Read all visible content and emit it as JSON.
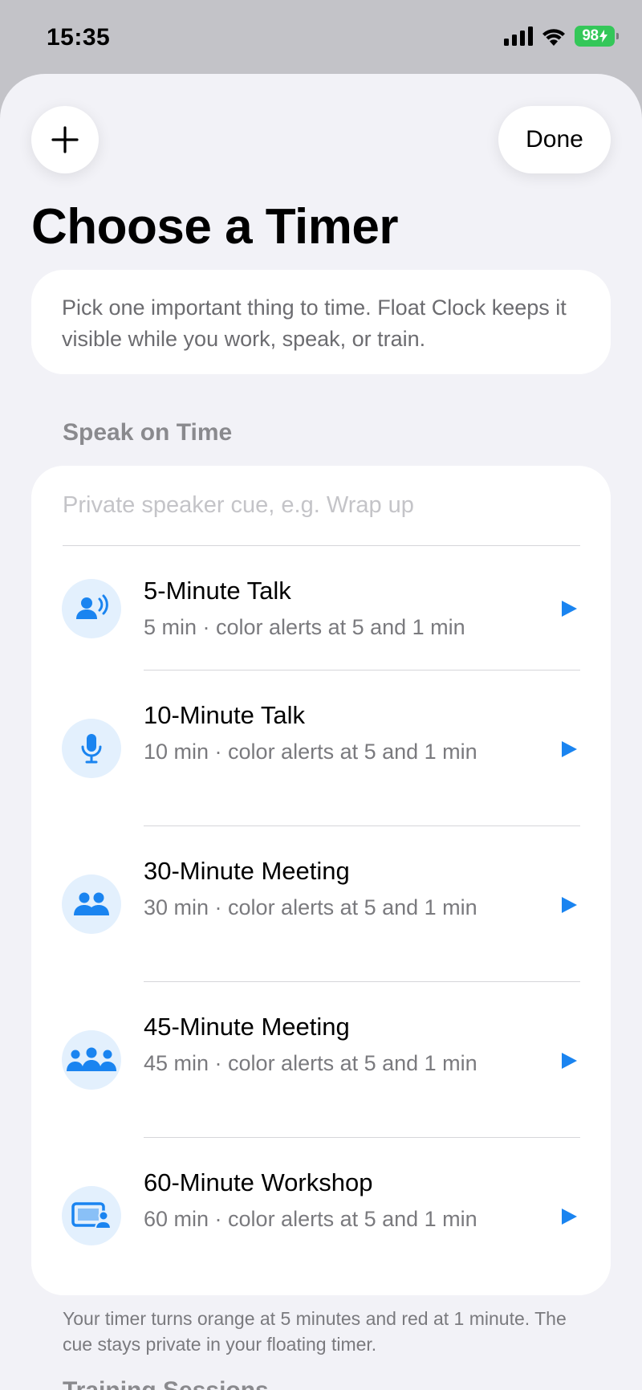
{
  "status": {
    "time": "15:35",
    "battery": "98"
  },
  "header": {
    "done_label": "Done",
    "title": "Choose a Timer"
  },
  "intro": "Pick one important thing to time. Float Clock keeps it visible while you work, speak, or train.",
  "section": {
    "title": "Speak on Time",
    "cue_placeholder": "Private speaker cue, e.g. Wrap up",
    "items": [
      {
        "title": "5-Minute Talk",
        "subtitle": "5 min · color alerts at 5 and 1 min",
        "icon": "speaker-icon"
      },
      {
        "title": "10-Minute Talk",
        "subtitle": "10 min · color alerts at 5 and 1 min",
        "icon": "microphone-icon"
      },
      {
        "title": "30-Minute Meeting",
        "subtitle": "30 min · color alerts at 5 and 1 min",
        "icon": "two-people-icon"
      },
      {
        "title": "45-Minute Meeting",
        "subtitle": "45 min · color alerts at 5 and 1 min",
        "icon": "three-people-icon"
      },
      {
        "title": "60-Minute Workshop",
        "subtitle": "60 min · color alerts at 5 and 1 min",
        "icon": "presentation-icon"
      }
    ],
    "footer": "Your timer turns orange at 5 minutes and red at 1 minute. The cue stays private in your floating timer."
  },
  "next_section": {
    "title": "Training Sessions"
  },
  "colors": {
    "accent": "#1a84f0",
    "icon_bg": "#e3f0fd",
    "sheet_bg": "#f2f2f7",
    "battery": "#34c759"
  }
}
